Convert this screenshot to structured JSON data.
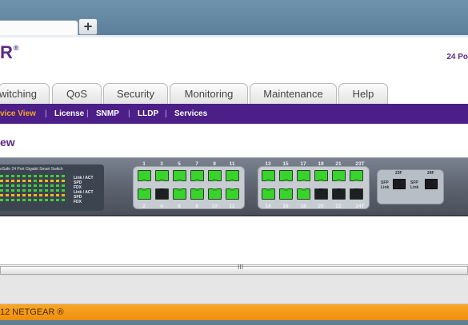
{
  "browser": {
    "newtab_symbol": "+"
  },
  "header": {
    "logo_partial": "R",
    "logo_mark": "®",
    "product_partial": "24 Po"
  },
  "main_tabs": [
    {
      "label": "witching"
    },
    {
      "label": "QoS"
    },
    {
      "label": "Security"
    },
    {
      "label": "Monitoring"
    },
    {
      "label": "Maintenance"
    },
    {
      "label": "Help"
    }
  ],
  "sub_nav": [
    {
      "label": "vice View",
      "active": true
    },
    {
      "label": "License"
    },
    {
      "label": "SNMP"
    },
    {
      "label": "LLDP"
    },
    {
      "label": "Services"
    }
  ],
  "page": {
    "title": "ew"
  },
  "device": {
    "panel_title": "oSafe 24 Port Gigabit Smart Switch",
    "led_labels": [
      "Link / ACT",
      "SPD",
      "FDX",
      "Link / ACT",
      "SPD",
      "FDX"
    ],
    "led_numbers": [
      "7",
      "8",
      "9",
      "10",
      "11",
      "12"
    ],
    "group1_top": [
      "1",
      "3",
      "5",
      "7",
      "9",
      "11"
    ],
    "group1_bottom": [
      "2",
      "4",
      "6",
      "8",
      "10",
      "12"
    ],
    "group2_top": [
      "13",
      "15",
      "17",
      "19",
      "21"
    ],
    "group2_bottom": [
      "14",
      "16",
      "18",
      "20",
      "22"
    ],
    "group1_top_status": [
      "green",
      "green",
      "green",
      "green",
      "green",
      "green"
    ],
    "group1_bottom_status": [
      "green",
      "black",
      "green",
      "green",
      "green",
      "green"
    ],
    "group2_top_status": [
      "green",
      "green",
      "green",
      "green",
      "green",
      "green"
    ],
    "group2_bottom_status": [
      "green",
      "green",
      "green",
      "black",
      "black",
      "black"
    ],
    "port23t_label": "23T",
    "port24t_label": "24T",
    "sfp_labels": [
      "23F",
      "24F"
    ],
    "sfp_caption": "SFP Link"
  },
  "scrollbar": {
    "grip": "III"
  },
  "footer": {
    "copyright": "12 NETGEAR ®"
  }
}
